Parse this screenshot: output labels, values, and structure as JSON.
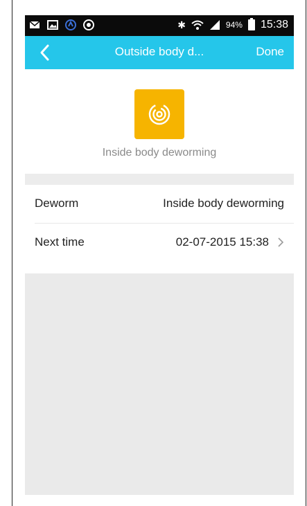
{
  "status_bar": {
    "battery_percent": "94%",
    "time": "15:38",
    "left_icons": [
      "mail-icon",
      "image-icon",
      "sync-icon",
      "alert-icon"
    ],
    "right_icons": [
      "bluetooth-icon",
      "wifi-icon",
      "signal-icon",
      "battery-icon"
    ]
  },
  "navbar": {
    "title": "Outside body d...",
    "done_label": "Done",
    "back_icon": "chevron-left-icon",
    "color": "#25c6ea"
  },
  "header": {
    "icon_name": "deworming-icon",
    "icon_color": "#f6b400",
    "caption": "Inside body deworming"
  },
  "rows": [
    {
      "label": "Deworm",
      "value": "Inside body deworming"
    },
    {
      "label": "Next time",
      "value": "02-07-2015 15:38"
    }
  ]
}
